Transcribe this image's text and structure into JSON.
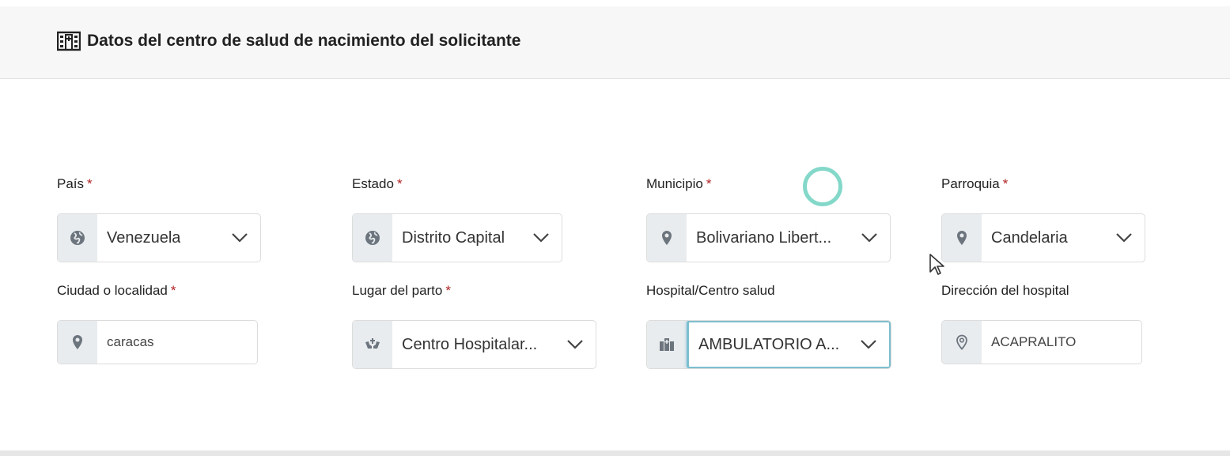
{
  "header": {
    "title": "Datos del centro de salud de nacimiento del solicitante",
    "icon": "hospital-icon"
  },
  "required_marker": "*",
  "fields": {
    "pais": {
      "label": "País",
      "value": "Venezuela",
      "icon": "globe-icon"
    },
    "estado": {
      "label": "Estado",
      "value": "Distrito Capital",
      "icon": "globe-icon"
    },
    "municipio": {
      "label": "Municipio",
      "value": "Bolivariano Libert...",
      "icon": "location-pin-icon"
    },
    "parroquia": {
      "label": "Parroquia",
      "value": "Candelaria",
      "icon": "location-pin-icon"
    },
    "ciudad": {
      "label": "Ciudad o localidad",
      "value": "caracas",
      "icon": "location-pin-icon"
    },
    "lugar_parto": {
      "label": "Lugar del parto",
      "value": "Centro Hospitalar...",
      "icon": "hands-care-icon"
    },
    "hospital": {
      "label": "Hospital/Centro salud",
      "value": "AMBULATORIO A...",
      "icon": "hospital-icon"
    },
    "direccion": {
      "label": "Dirección del hospital",
      "value": "ACAPRALITO",
      "icon": "location-outline-icon"
    }
  },
  "colors": {
    "focus_border": "#7cbfcf",
    "required": "#b22222",
    "click_ring": "#6fd1c0"
  }
}
